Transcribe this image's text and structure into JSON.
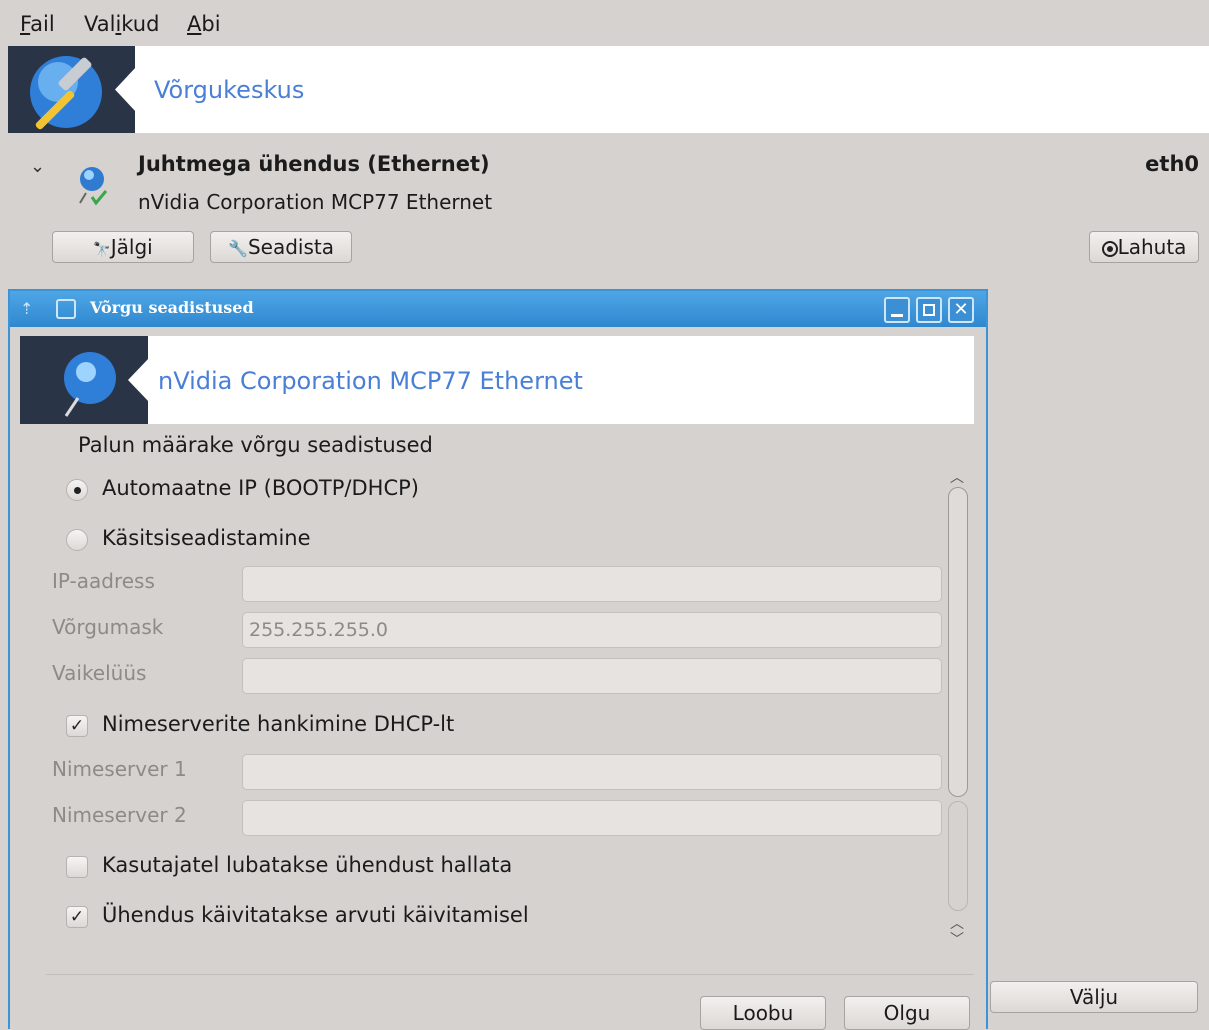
{
  "menubar": {
    "items": [
      {
        "mnemonic": "F",
        "rest": "ail"
      },
      {
        "pre": "Val",
        "mnemonic": "i",
        "rest": "kud"
      },
      {
        "mnemonic": "A",
        "rest": "bi"
      }
    ]
  },
  "header": {
    "title": "Võrgukeskus"
  },
  "device": {
    "title": "Juhtmega ühendus (Ethernet)",
    "subtitle": "nVidia Corporation MCP77 Ethernet",
    "interface": "eth0",
    "monitor_label": "Jälgi",
    "configure_label": "Seadista",
    "disconnect_label": "Lahuta",
    "quit_label": "Välju"
  },
  "dialog": {
    "title": "Võrgu seadistused",
    "header_title": "nVidia Corporation MCP77 Ethernet",
    "intro": "Palun määrake võrgu seadistused",
    "radio_auto": "Automaatne IP (BOOTP/DHCP)",
    "radio_manual": "Käsitsiseadistamine",
    "selected_mode": "auto",
    "fields": {
      "ip_label": "IP-aadress",
      "ip_value": "",
      "netmask_label": "Võrgumask",
      "netmask_value": "255.255.255.0",
      "gateway_label": "Vaikelüüs",
      "gateway_value": "",
      "dns1_label": "Nimeserver 1",
      "dns1_value": "",
      "dns2_label": "Nimeserver 2",
      "dns2_value": ""
    },
    "check_dns_dhcp": {
      "label": "Nimeserverite hankimine DHCP-lt",
      "checked": true
    },
    "check_users": {
      "label": "Kasutajatel lubatakse ühendust hallata",
      "checked": false
    },
    "check_boot": {
      "label": "Ühendus käivitatakse arvuti käivitamisel",
      "checked": true
    },
    "cancel_label": "Loobu",
    "ok_label": "Olgu"
  }
}
